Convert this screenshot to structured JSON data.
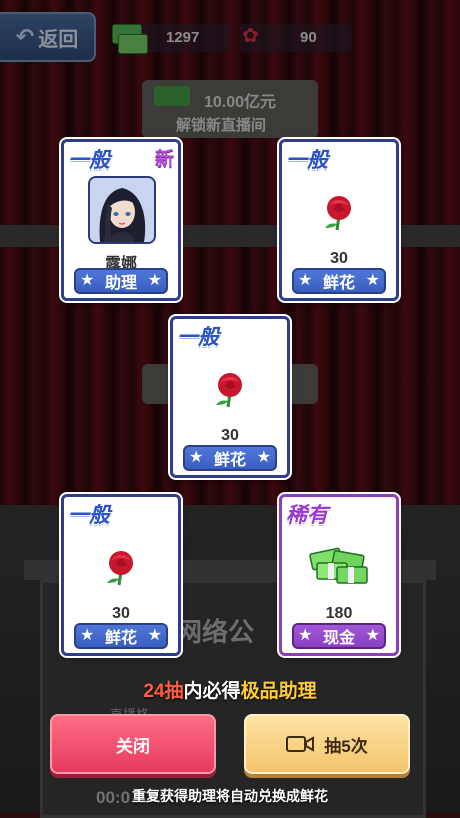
{
  "topbar": {
    "back_label": "返回",
    "cash_value": "1297",
    "flower_value": "90"
  },
  "background": {
    "sign_amount": "10.00亿元",
    "sign_subtitle": "解锁新直播间",
    "wall_text": "狸网络公",
    "small_text": "直播格",
    "timer": "00:0"
  },
  "cards": [
    {
      "rarity": "一般",
      "new_tag": "新",
      "name": "露娜",
      "tag_label": "助理",
      "kind": "assistant"
    },
    {
      "rarity": "一般",
      "amount": "30",
      "tag_label": "鲜花",
      "kind": "flower"
    },
    {
      "rarity": "一般",
      "amount": "30",
      "tag_label": "鲜花",
      "kind": "flower"
    },
    {
      "rarity": "一般",
      "amount": "30",
      "tag_label": "鲜花",
      "kind": "flower"
    },
    {
      "rarity": "稀有",
      "amount": "180",
      "tag_label": "现金",
      "kind": "cash"
    }
  ],
  "guarantee": {
    "count": "24抽",
    "middle": "内必得",
    "highlight": "极品助理"
  },
  "buttons": {
    "close_label": "关闭",
    "draw_label": "抽5次"
  },
  "footnote": "重复获得助理将自动兑换成鲜花",
  "colors": {
    "common": "#2b52c9",
    "rare": "#9a3ad0",
    "close_button": "#e63a5e",
    "draw_button": "#f3c46c",
    "highlight": "#ffcc33",
    "count": "#ff5d3f"
  }
}
